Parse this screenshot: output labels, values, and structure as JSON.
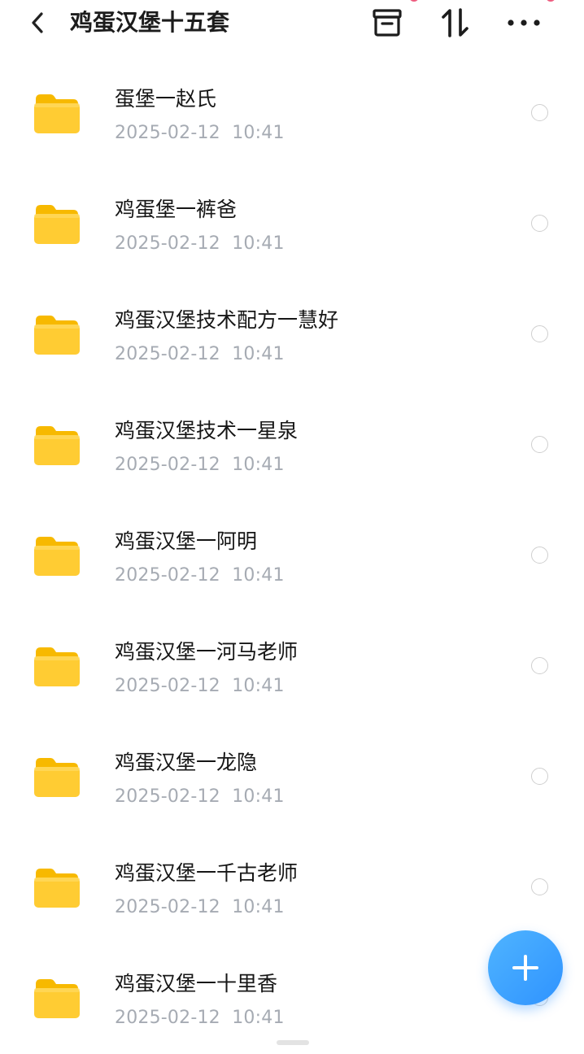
{
  "header": {
    "title": "鸡蛋汉堡十五套",
    "back_icon": "chevron-left-icon",
    "actions": [
      "archive-icon",
      "sort-icon",
      "more-icon"
    ]
  },
  "folders": [
    {
      "name": "蛋堡一赵氏",
      "date": "2025-02-12  10:41"
    },
    {
      "name": "鸡蛋堡一裤爸",
      "date": "2025-02-12  10:41"
    },
    {
      "name": "鸡蛋汉堡技术配方一慧好",
      "date": "2025-02-12  10:41"
    },
    {
      "name": "鸡蛋汉堡技术一星泉",
      "date": "2025-02-12  10:41"
    },
    {
      "name": "鸡蛋汉堡一阿明",
      "date": "2025-02-12  10:41"
    },
    {
      "name": "鸡蛋汉堡一河马老师",
      "date": "2025-02-12  10:41"
    },
    {
      "name": "鸡蛋汉堡一龙隐",
      "date": "2025-02-12  10:41"
    },
    {
      "name": "鸡蛋汉堡一千古老师",
      "date": "2025-02-12  10:41"
    },
    {
      "name": "鸡蛋汉堡一十里香",
      "date": "2025-02-12  10:41"
    }
  ],
  "fab": {
    "icon": "plus-icon"
  },
  "colors": {
    "folder": "#FFCC33",
    "date_text": "#A6ABB3",
    "fab": "#3A9DFF",
    "notification": "#EE5C7F"
  }
}
